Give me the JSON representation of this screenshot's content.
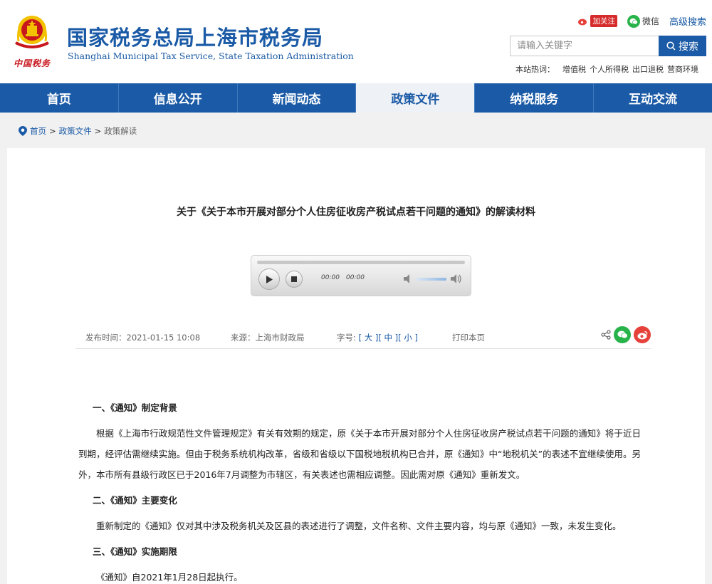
{
  "header": {
    "site_title": "国家税务总局上海市税务局",
    "site_subtitle": "Shanghai Municipal Tax Service, State Taxation Administration",
    "seal_text": "中国税务",
    "weibo_follow": "加关注",
    "wechat_label": "微信",
    "advanced_search": "高级搜索",
    "search_placeholder": "请输入关键字",
    "search_button": "搜索",
    "hot_label": "本站热词：",
    "hot_words": [
      "增值税",
      "个人所得税",
      "出口退税",
      "营商环境"
    ]
  },
  "nav": {
    "items": [
      "首页",
      "信息公开",
      "新闻动态",
      "政策文件",
      "纳税服务",
      "互动交流"
    ],
    "active_index": 3
  },
  "breadcrumb": {
    "home": "首页",
    "sep": ">",
    "level1": "政策文件",
    "current": "政策解读"
  },
  "article": {
    "title": "关于《关于本市开展对部分个人住房征收房产税试点若干问题的通知》的解读材料",
    "player": {
      "current_time": "00:00",
      "duration": "00:00"
    },
    "meta": {
      "publish_label": "发布时间：",
      "publish_time": "2021-01-15 10:08",
      "source_label": "来源：",
      "source": "上海市财政局",
      "font_label": "字号:",
      "font_large": "大",
      "font_medium": "中",
      "font_small": "小",
      "print": "打印本页"
    },
    "sections": [
      {
        "heading": "一、《通知》制定背景",
        "paragraph": "根据《上海市行政规范性文件管理规定》有关有效期的规定，原《关于本市开展对部分个人住房征收房产税试点若干问题的通知》将于近日到期，经评估需继续实施。但由于税务系统机构改革，省级和省级以下国税地税机构已合并，原《通知》中“地税机关”的表述不宜继续使用。另外，本市所有县级行政区已于2016年7月调整为市辖区，有关表述也需相应调整。因此需对原《通知》重新发文。"
      },
      {
        "heading": "二、《通知》主要变化",
        "paragraph": "重新制定的《通知》仅对其中涉及税务机关及区县的表述进行了调整，文件名称、文件主要内容，均与原《通知》一致，未发生变化。"
      },
      {
        "heading": "三、《通知》实施期限",
        "paragraph": "《通知》自2021年1月28日起执行。"
      }
    ]
  },
  "colors": {
    "brand_blue": "#1a5aa6",
    "seal_red": "#c8161d",
    "wechat_green": "#28b34a",
    "weibo_red": "#e6423b"
  }
}
